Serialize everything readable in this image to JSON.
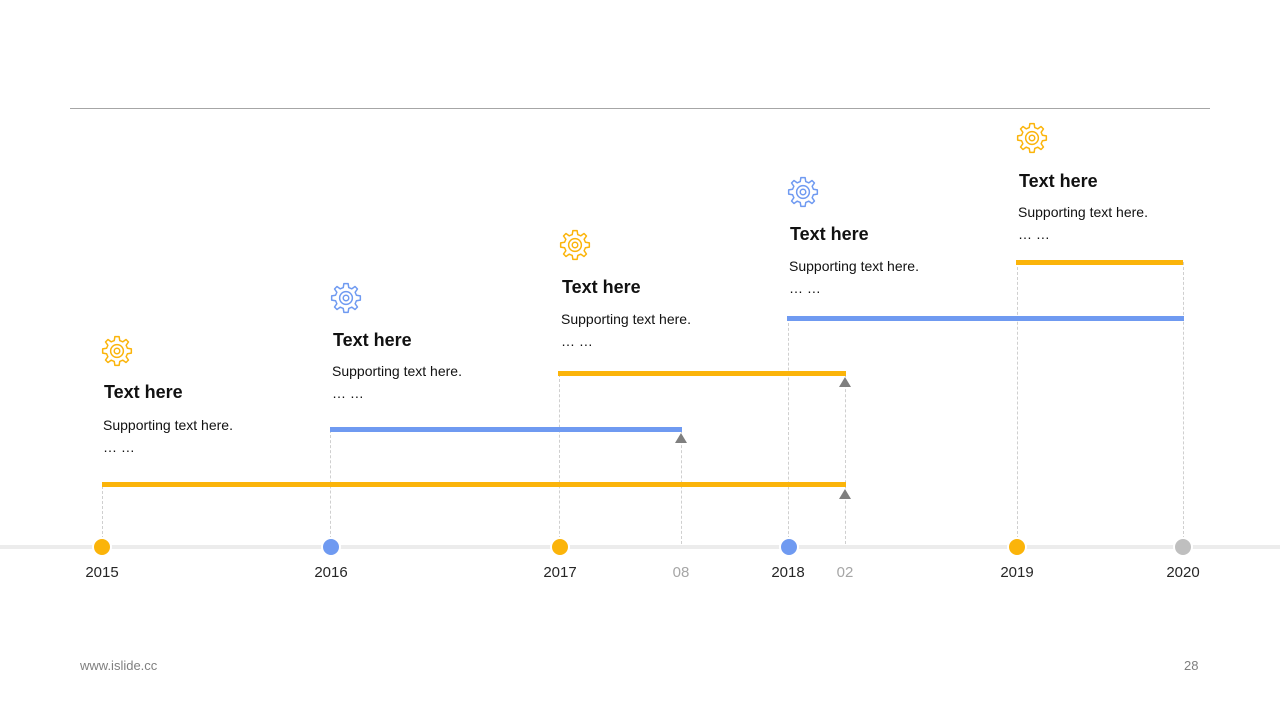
{
  "colors": {
    "yellow": "#fbb40a",
    "blue": "#6f9af1",
    "grey": "#bfbfbf",
    "arrow": "#7f7f7f"
  },
  "axis_labels": {
    "y2015": "2015",
    "y2016": "2016",
    "y2017": "2017",
    "m08": "08",
    "y2018": "2018",
    "m02": "02",
    "y2019": "2019",
    "y2020": "2020"
  },
  "milestones": [
    {
      "icon": "gear-icon",
      "title": "Text here",
      "support": "Supporting text here.",
      "ellipsis": "… …",
      "start": "2015",
      "end": "02"
    },
    {
      "icon": "gear-icon",
      "title": "Text here",
      "support": "Supporting text here.",
      "ellipsis": "… …",
      "start": "2016",
      "end": "08"
    },
    {
      "icon": "gear-icon",
      "title": "Text here",
      "support": "Supporting text here.",
      "ellipsis": "… …",
      "start": "2017",
      "end": "02"
    },
    {
      "icon": "gear-icon",
      "title": "Text here",
      "support": "Supporting text here.",
      "ellipsis": "… …",
      "start": "2018",
      "end": "2020"
    },
    {
      "icon": "gear-icon",
      "title": "Text here",
      "support": "Supporting text here.",
      "ellipsis": "… …",
      "start": "2019",
      "end": "2020"
    }
  ],
  "footer": {
    "url": "www.islide.cc",
    "page": "28"
  }
}
